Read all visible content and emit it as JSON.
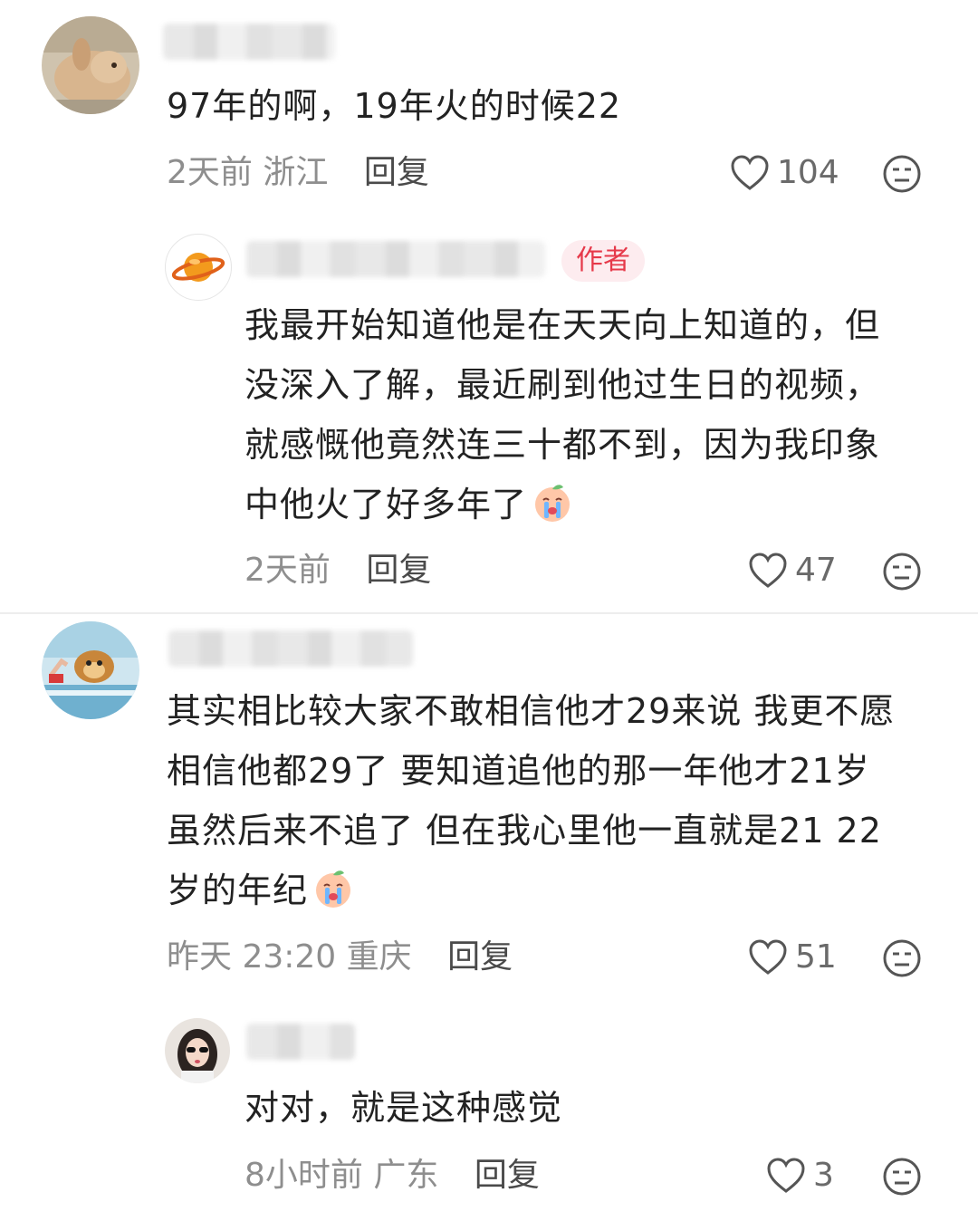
{
  "comments": [
    {
      "text_lines": [
        "97年的啊，19年火的时候22"
      ],
      "time": "2天前",
      "location": "浙江",
      "reply_label": "回复",
      "likes": "104",
      "is_author": false
    },
    {
      "text_lines": [
        "我最开始知道他是在天天向上知道的，但",
        "没深入了解，最近刷到他过生日的视频，",
        "就感慨他竟然连三十都不到，因为我印象",
        "中他火了好多年了"
      ],
      "time": "2天前",
      "location": "",
      "reply_label": "回复",
      "likes": "47",
      "is_author": true,
      "author_badge": "作者"
    },
    {
      "text_lines": [
        "其实相比较大家不敢相信他才29来说 我更不愿",
        "相信他都29了 要知道追他的那一年他才21岁",
        "虽然后来不追了 但在我心里他一直就是21 22",
        "岁的年纪"
      ],
      "time": "昨天 23:20",
      "location": "重庆",
      "reply_label": "回复",
      "likes": "51",
      "is_author": false
    },
    {
      "text_lines": [
        "对对，就是这种感觉"
      ],
      "time": "8小时前",
      "location": "广东",
      "reply_label": "回复",
      "likes": "3",
      "is_author": false
    }
  ],
  "icons": {
    "like": "heart-outline-icon",
    "dislike": "meh-face-icon",
    "sticker": "crying-peach-emoji"
  },
  "colors": {
    "author_badge_bg": "#fdecef",
    "author_badge_text": "#e6394a",
    "meta_text": "#8e8e8e"
  }
}
